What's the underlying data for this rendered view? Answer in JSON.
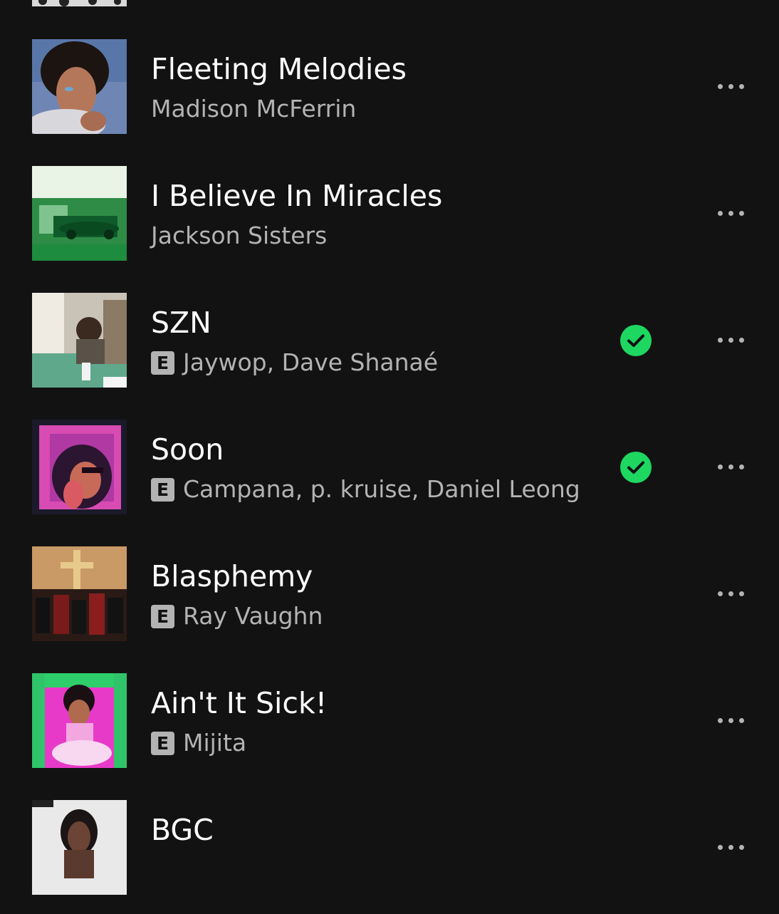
{
  "accent_color": "#1ed760",
  "tracks": [
    {
      "title": "Fleeting Melodies",
      "artists": "Madison McFerrin",
      "explicit": false,
      "downloaded": false,
      "cover": "woman-portrait-cover"
    },
    {
      "title": "I Believe In Miracles",
      "artists": "Jackson Sisters",
      "explicit": false,
      "downloaded": false,
      "cover": "green-funked-cover"
    },
    {
      "title": "SZN",
      "artists": "Jaywop, Dave Shanaé",
      "explicit": true,
      "downloaded": true,
      "cover": "porch-cover"
    },
    {
      "title": "Soon",
      "artists": "Campana, p. kruise, Daniel Leong",
      "explicit": true,
      "downloaded": true,
      "cover": "pink-glow-cover"
    },
    {
      "title": "Blasphemy",
      "artists": "Ray Vaughn",
      "explicit": true,
      "downloaded": false,
      "cover": "church-cover"
    },
    {
      "title": "Ain't It Sick!",
      "artists": "Mijita",
      "explicit": true,
      "downloaded": false,
      "cover": "pink-throne-cover"
    },
    {
      "title": "BGC",
      "artists": "",
      "explicit": false,
      "downloaded": false,
      "cover": "mugshot-cover"
    }
  ],
  "explicit_label": "E",
  "icons": {
    "more": "more-options-icon",
    "downloaded": "downloaded-check-icon"
  }
}
